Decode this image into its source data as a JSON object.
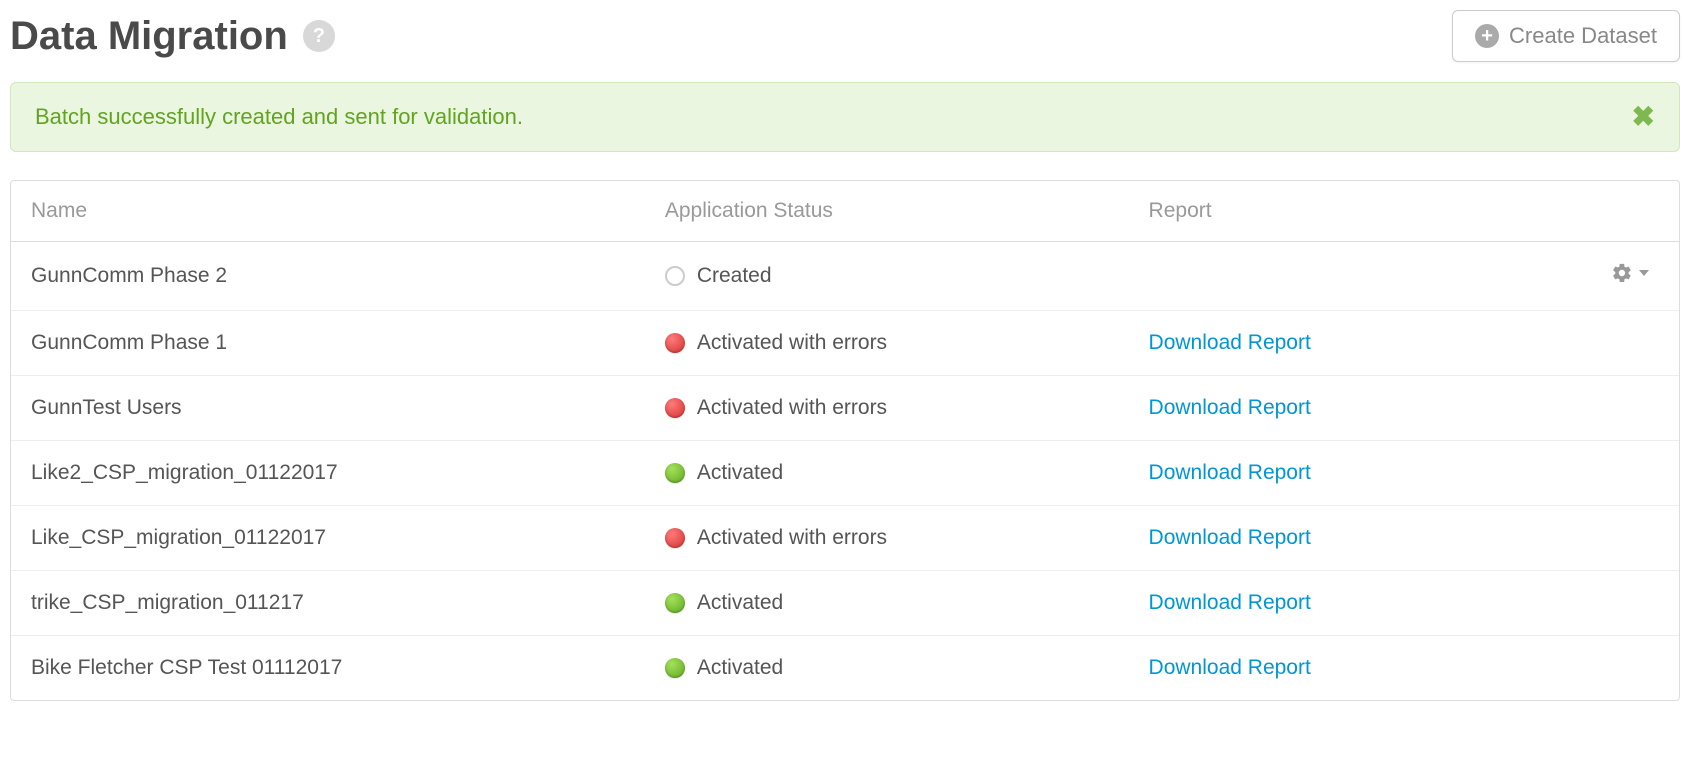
{
  "page": {
    "title": "Data Migration",
    "create_button_label": "Create Dataset"
  },
  "alert": {
    "message": "Batch successfully created and sent for validation."
  },
  "table": {
    "headers": {
      "name": "Name",
      "status": "Application Status",
      "report": "Report"
    },
    "report_link_label": "Download Report",
    "rows": [
      {
        "name": "GunnComm Phase 2",
        "status_label": "Created",
        "status_kind": "created",
        "has_report": false,
        "has_actions": true
      },
      {
        "name": "GunnComm Phase 1",
        "status_label": "Activated with errors",
        "status_kind": "error",
        "has_report": true,
        "has_actions": false
      },
      {
        "name": "GunnTest Users",
        "status_label": "Activated with errors",
        "status_kind": "error",
        "has_report": true,
        "has_actions": false
      },
      {
        "name": "Like2_CSP_migration_01122017",
        "status_label": "Activated",
        "status_kind": "activated",
        "has_report": true,
        "has_actions": false
      },
      {
        "name": "Like_CSP_migration_01122017",
        "status_label": "Activated with errors",
        "status_kind": "error",
        "has_report": true,
        "has_actions": false
      },
      {
        "name": "trike_CSP_migration_011217",
        "status_label": "Activated",
        "status_kind": "activated",
        "has_report": true,
        "has_actions": false
      },
      {
        "name": "Bike Fletcher CSP Test 01112017",
        "status_label": "Activated",
        "status_kind": "activated",
        "has_report": true,
        "has_actions": false
      }
    ]
  }
}
